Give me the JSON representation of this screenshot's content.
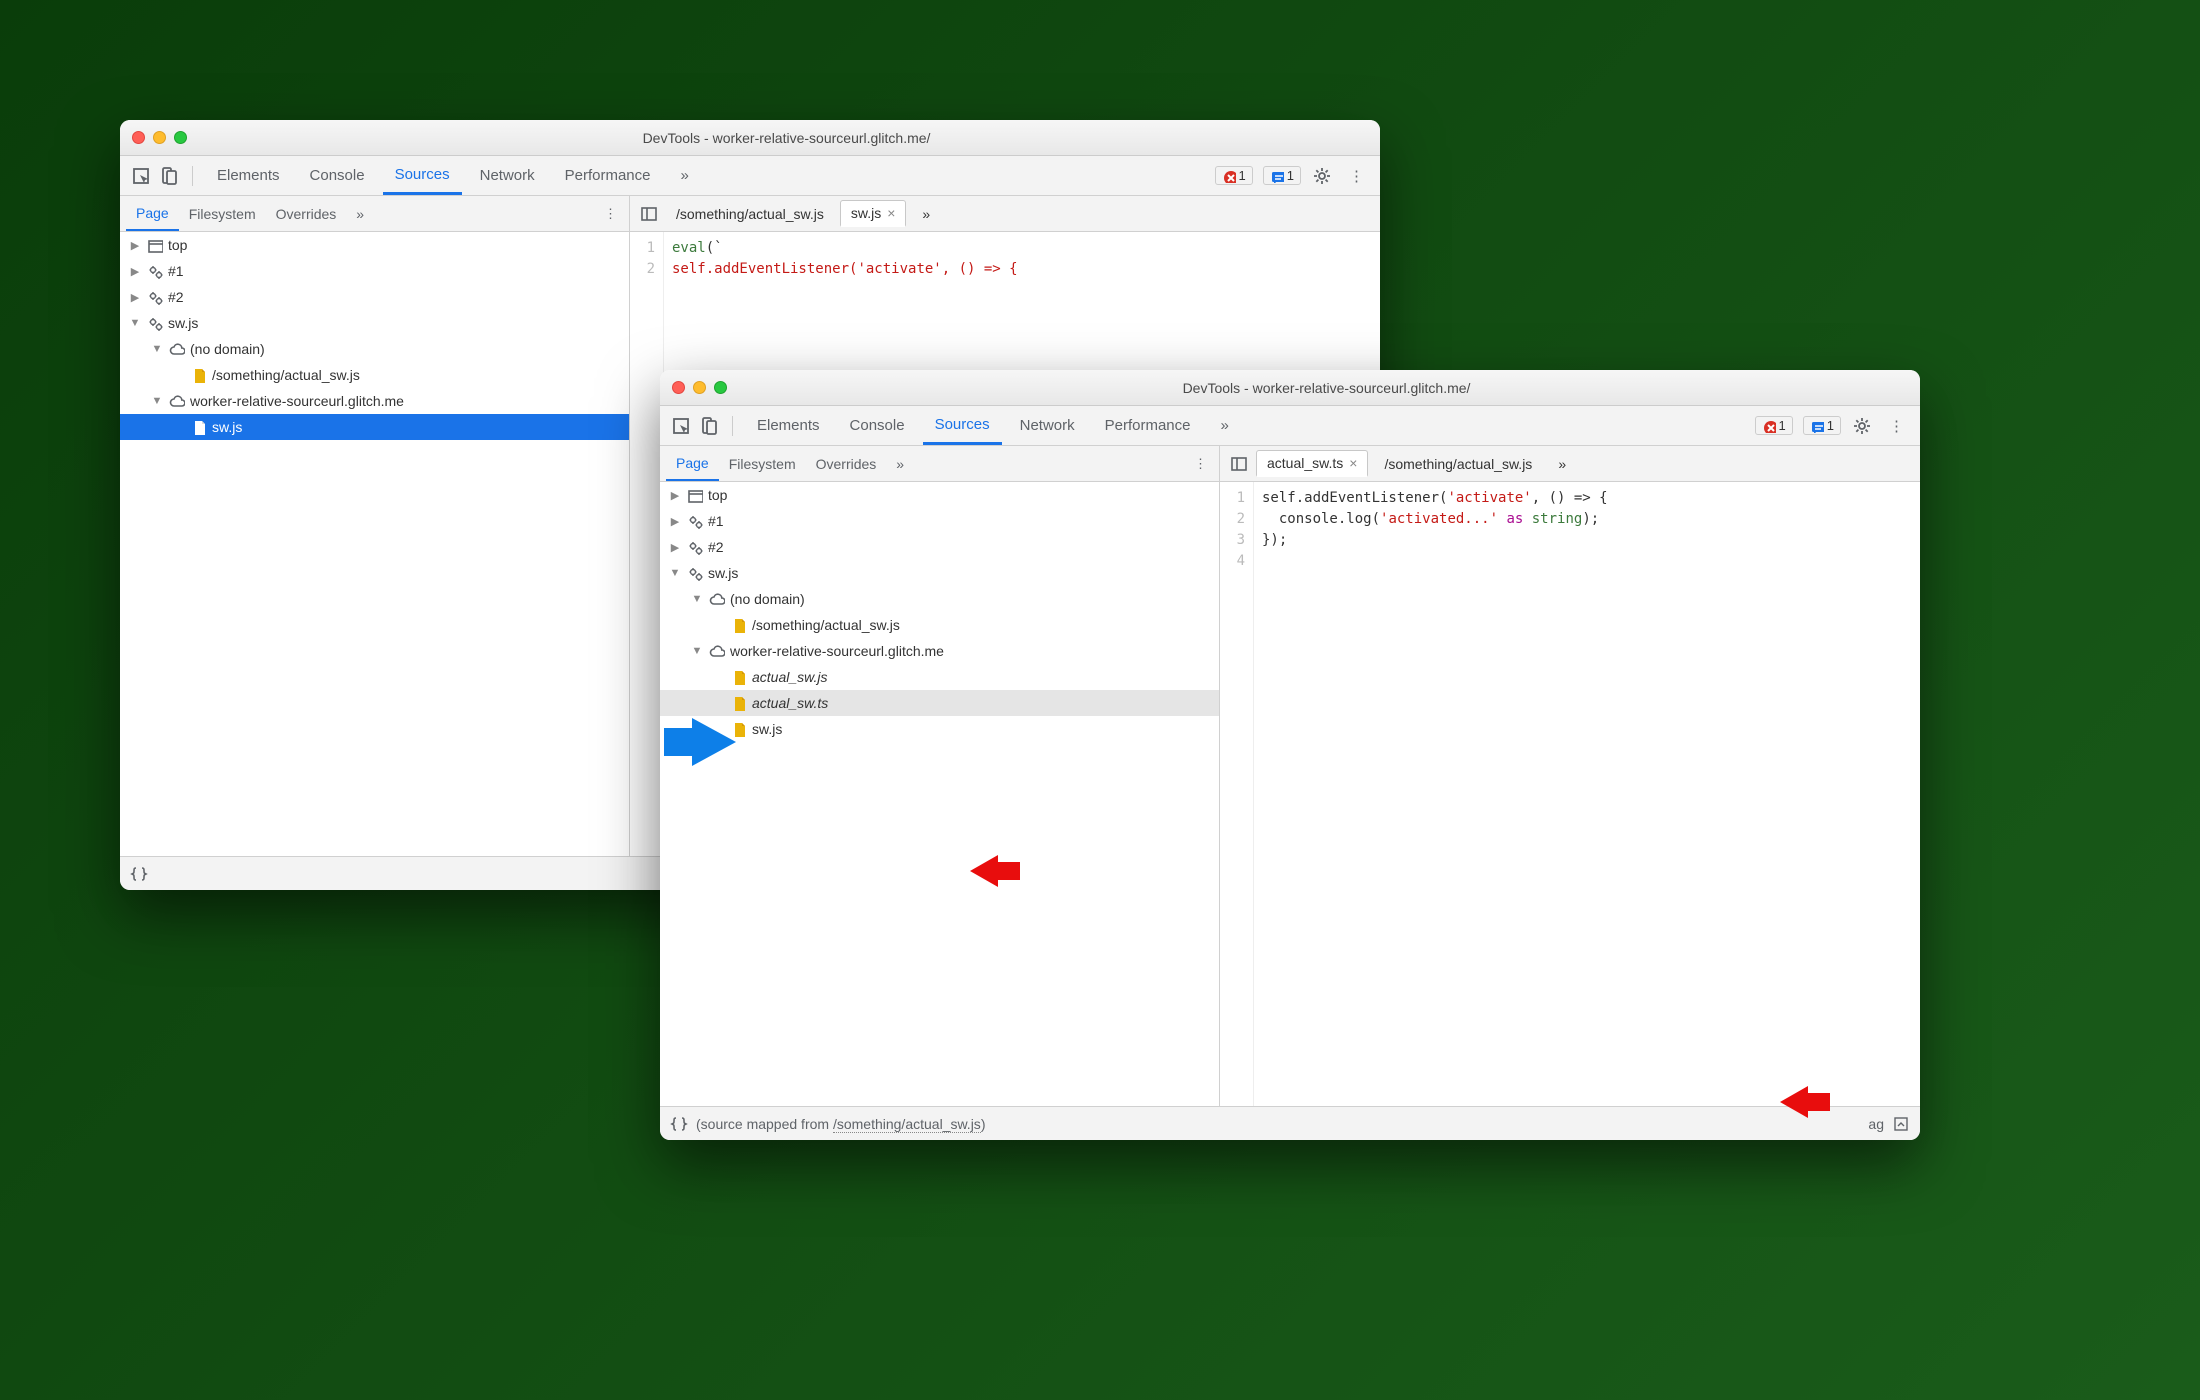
{
  "window1": {
    "title": "DevTools - worker-relative-sourceurl.glitch.me/",
    "tabs": [
      "Elements",
      "Console",
      "Sources",
      "Network",
      "Performance"
    ],
    "active_tab": "Sources",
    "errors": "1",
    "messages": "1",
    "subtabs": [
      "Page",
      "Filesystem",
      "Overrides"
    ],
    "active_subtab": "Page",
    "file_tabs": [
      {
        "label": "/something/actual_sw.js",
        "active": false
      },
      {
        "label": "sw.js",
        "active": true
      }
    ],
    "tree": [
      {
        "depth": 0,
        "icon": "frame",
        "label": "top",
        "chev": "▶"
      },
      {
        "depth": 0,
        "icon": "gear",
        "label": "#1",
        "chev": "▶"
      },
      {
        "depth": 0,
        "icon": "gear",
        "label": "#2",
        "chev": "▶"
      },
      {
        "depth": 0,
        "icon": "gear",
        "label": "sw.js",
        "chev": "▼"
      },
      {
        "depth": 1,
        "icon": "cloud",
        "label": "(no domain)",
        "chev": "▼"
      },
      {
        "depth": 2,
        "icon": "file",
        "label": "/something/actual_sw.js"
      },
      {
        "depth": 1,
        "icon": "cloud",
        "label": "worker-relative-sourceurl.glitch.me",
        "chev": "▼"
      },
      {
        "depth": 2,
        "icon": "file",
        "label": "sw.js",
        "selected": true
      }
    ],
    "code_lines": [
      "1",
      "2"
    ],
    "code": {
      "l1_a": "eval",
      "l1_b": "(`",
      "l2_a": "self.addEventListener(",
      "l2_b": "'activate'",
      "l2_c": ", () => {"
    }
  },
  "window2": {
    "title": "DevTools - worker-relative-sourceurl.glitch.me/",
    "tabs": [
      "Elements",
      "Console",
      "Sources",
      "Network",
      "Performance"
    ],
    "active_tab": "Sources",
    "errors": "1",
    "messages": "1",
    "subtabs": [
      "Page",
      "Filesystem",
      "Overrides"
    ],
    "active_subtab": "Page",
    "file_tabs": [
      {
        "label": "actual_sw.ts",
        "active": true
      },
      {
        "label": "/something/actual_sw.js",
        "active": false
      }
    ],
    "tree": [
      {
        "depth": 0,
        "icon": "frame",
        "label": "top",
        "chev": "▶"
      },
      {
        "depth": 0,
        "icon": "gear",
        "label": "#1",
        "chev": "▶"
      },
      {
        "depth": 0,
        "icon": "gear",
        "label": "#2",
        "chev": "▶"
      },
      {
        "depth": 0,
        "icon": "gear",
        "label": "sw.js",
        "chev": "▼"
      },
      {
        "depth": 1,
        "icon": "cloud",
        "label": "(no domain)",
        "chev": "▼"
      },
      {
        "depth": 2,
        "icon": "file",
        "label": "/something/actual_sw.js"
      },
      {
        "depth": 1,
        "icon": "cloud",
        "label": "worker-relative-sourceurl.glitch.me",
        "chev": "▼"
      },
      {
        "depth": 2,
        "icon": "file",
        "label": "actual_sw.js",
        "italic": true
      },
      {
        "depth": 2,
        "icon": "file",
        "label": "actual_sw.ts",
        "italic": true,
        "highlighted": true
      },
      {
        "depth": 2,
        "icon": "file",
        "label": "sw.js"
      }
    ],
    "code_lines": [
      "1",
      "2",
      "3",
      "4"
    ],
    "code": {
      "l1_a": "self.addEventListener(",
      "l1_b": "'activate'",
      "l1_c": ", () => {",
      "l2_a": "  console.log(",
      "l2_b": "'activated...'",
      "l2_c": " as ",
      "l2_d": "string",
      "l2_e": ");",
      "l3": "});"
    },
    "footer_prefix": "(source mapped from ",
    "footer_link": "/something/actual_sw.js",
    "footer_suffix": ")",
    "footer_extra": "ag"
  }
}
